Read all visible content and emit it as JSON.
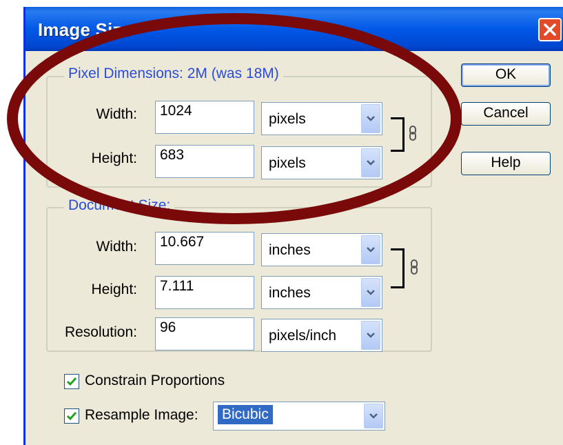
{
  "window": {
    "title": "Image Size",
    "title_color": "#ffffff",
    "accent": "#0058e6",
    "close_icon": "close-icon"
  },
  "pixel_dimensions": {
    "legend": "Pixel Dimensions:  2M (was 18M)",
    "width_label": "Width:",
    "width_value": "1024",
    "width_unit": "pixels",
    "height_label": "Height:",
    "height_value": "683",
    "height_unit": "pixels",
    "link_icon": "chain-link-icon"
  },
  "document_size": {
    "legend": "Document Size:",
    "width_label": "Width:",
    "width_value": "10.667",
    "width_unit": "inches",
    "height_label": "Height:",
    "height_value": "7.111",
    "height_unit": "inches",
    "resolution_label": "Resolution:",
    "resolution_value": "96",
    "resolution_unit": "pixels/inch",
    "link_icon": "chain-link-icon"
  },
  "options": {
    "constrain_label": "Constrain Proportions",
    "constrain_checked": true,
    "resample_label": "Resample Image:",
    "resample_checked": true,
    "resample_method": "Bicubic"
  },
  "buttons": {
    "ok": "OK",
    "cancel": "Cancel",
    "help": "Help"
  },
  "annotation": {
    "shape": "ellipse",
    "color": "#7a0a0a",
    "target": "pixel-dimensions-group"
  }
}
